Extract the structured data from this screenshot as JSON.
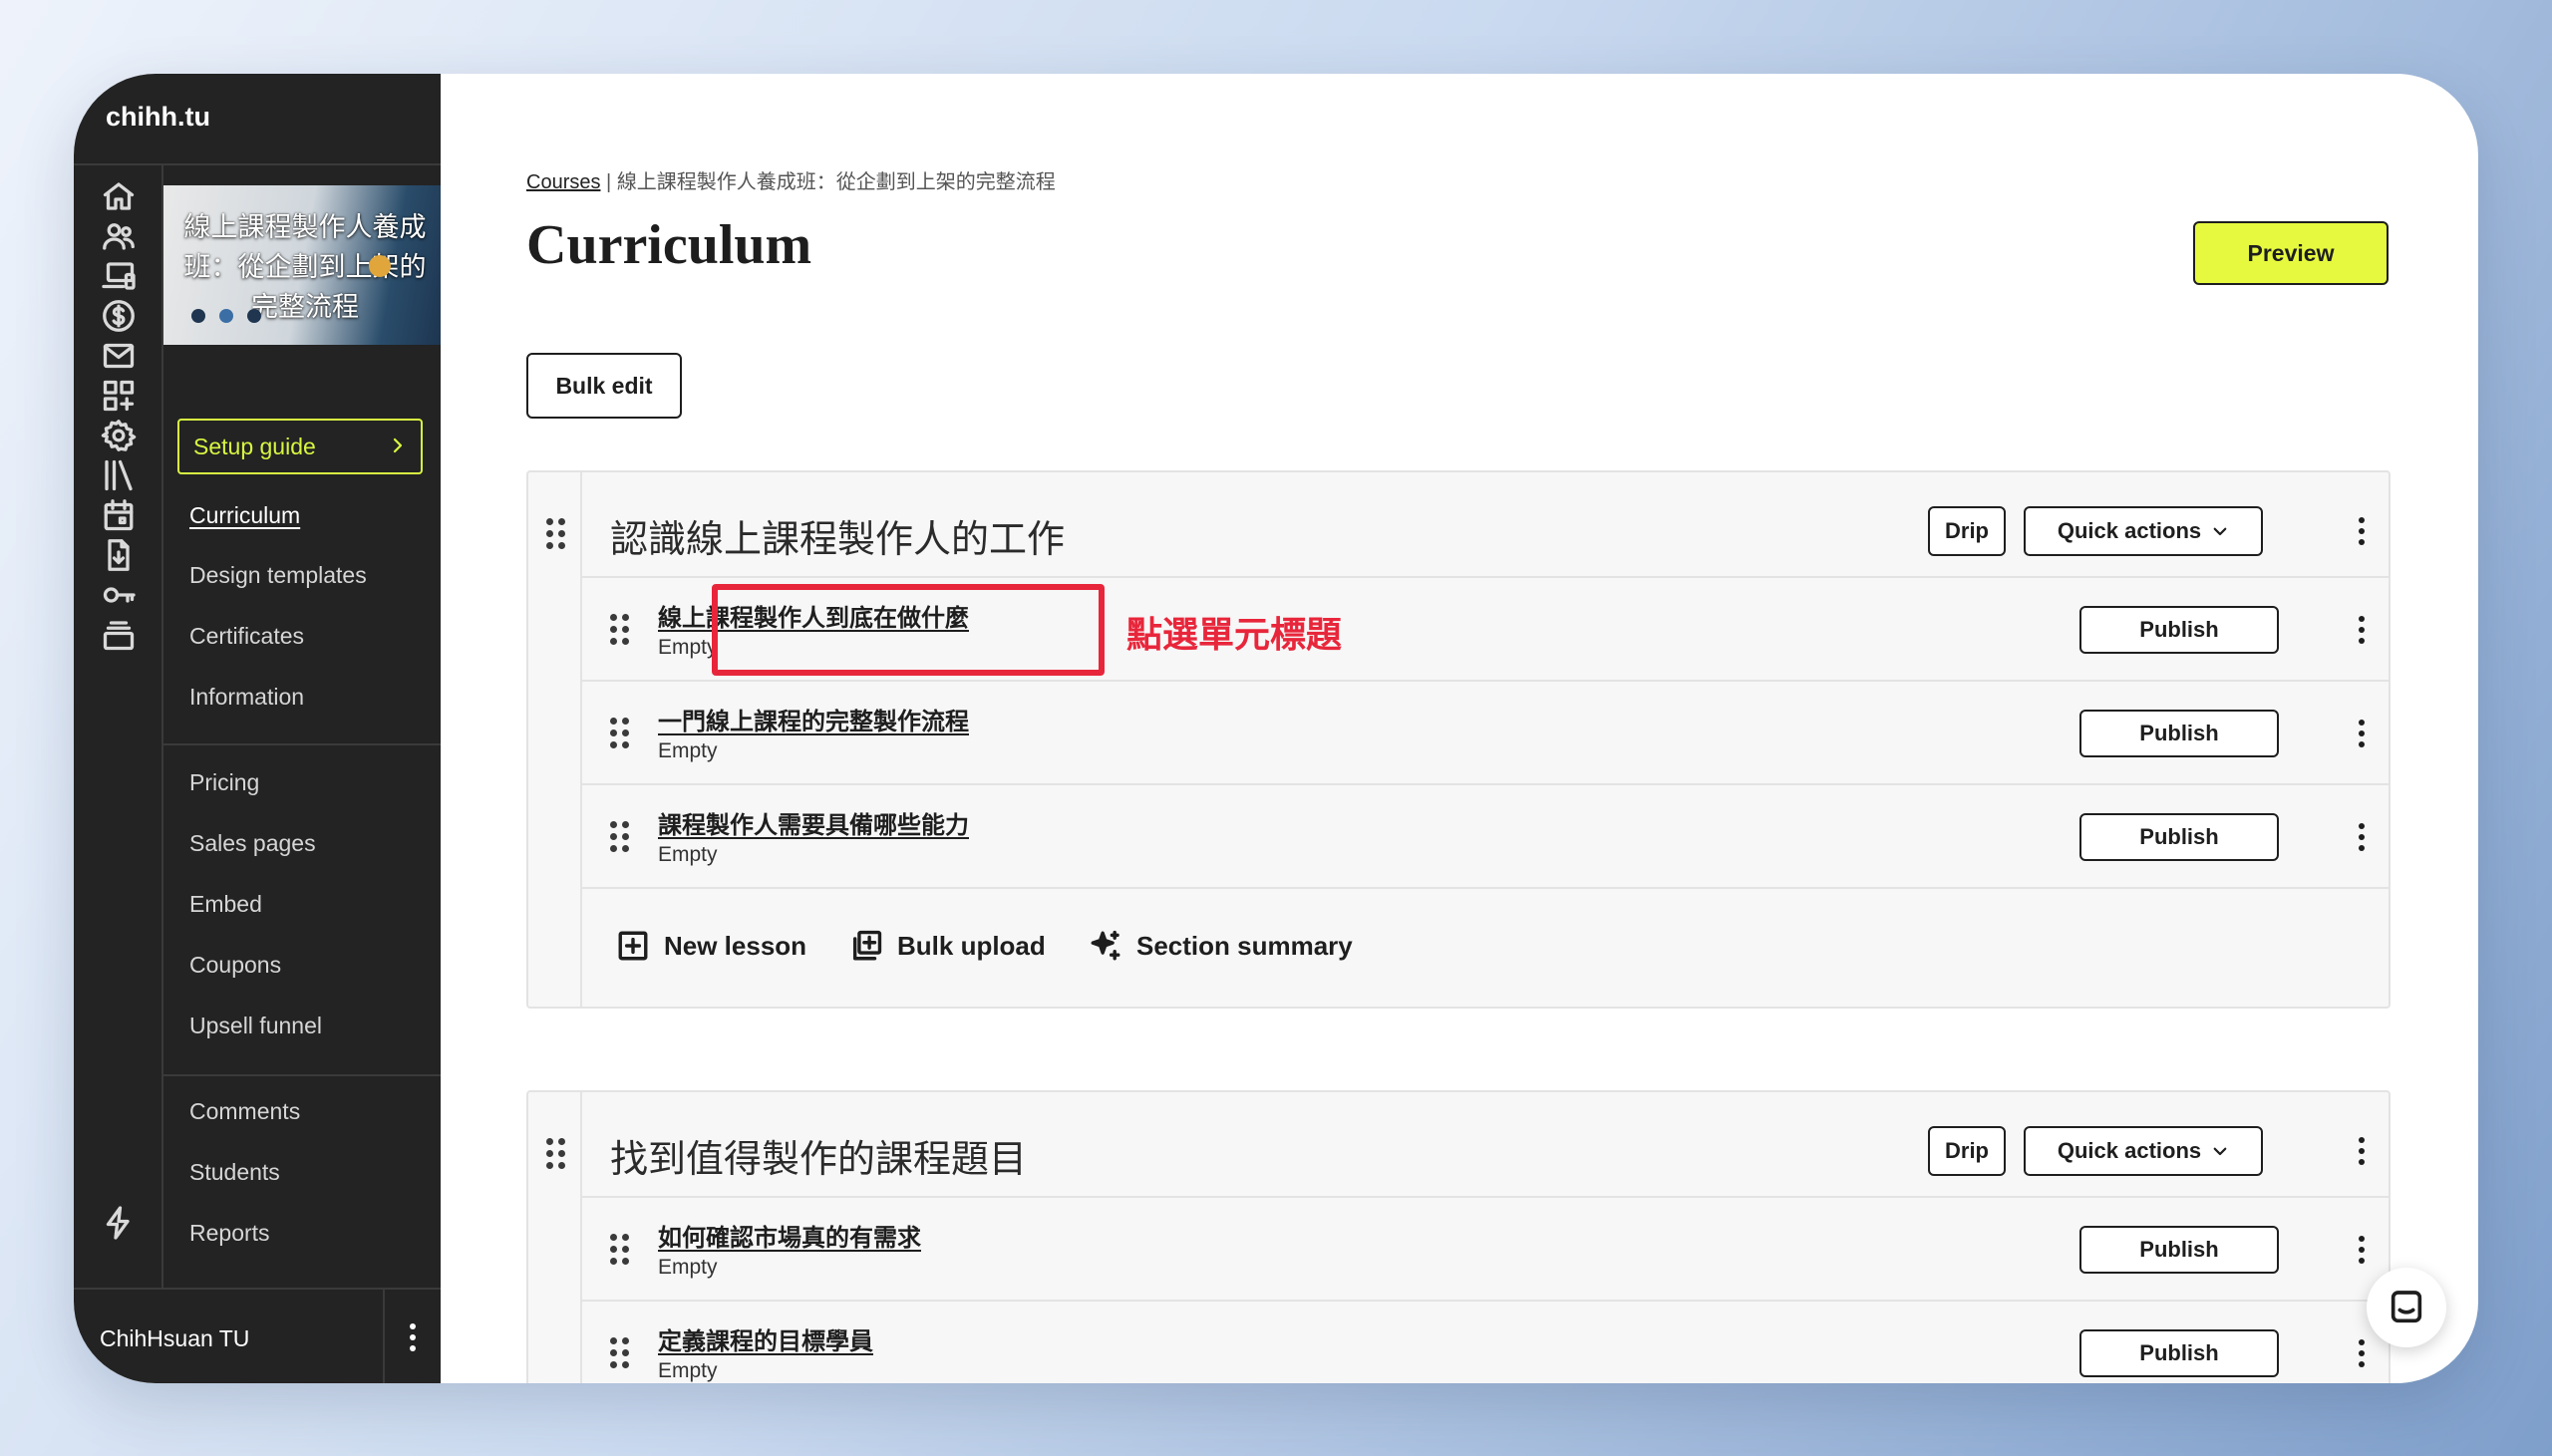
{
  "brand": "chihh.tu",
  "course_thumb": {
    "text": "線上課程製作人養成班：從企劃到上架的完整流程"
  },
  "setup_guide": "Setup guide",
  "nav": {
    "group1": [
      "Curriculum",
      "Design templates",
      "Certificates",
      "Information"
    ],
    "group2": [
      "Pricing",
      "Sales pages",
      "Embed",
      "Coupons",
      "Upsell funnel"
    ],
    "group3": [
      "Comments",
      "Students",
      "Reports"
    ],
    "active": "Curriculum"
  },
  "rail_icons": [
    "home-icon",
    "users-icon",
    "devices-icon",
    "dollar-icon",
    "mail-icon",
    "apps-icon",
    "gear-icon",
    "library-icon",
    "calendar-icon",
    "download-doc-icon",
    "key-icon",
    "stack-icon",
    "lightning-icon"
  ],
  "user": {
    "name": "ChihHsuan TU"
  },
  "breadcrumb": {
    "root": "Courses",
    "separator": "|",
    "current": "線上課程製作人養成班：從企劃到上架的完整流程"
  },
  "page_title": "Curriculum",
  "buttons": {
    "preview": "Preview",
    "bulk_edit": "Bulk edit",
    "drip": "Drip",
    "quick_actions": "Quick actions",
    "publish": "Publish"
  },
  "sections": [
    {
      "title": "認識線上課程製作人的工作",
      "lessons": [
        {
          "title": "線上課程製作人到底在做什麼",
          "status": "Empty"
        },
        {
          "title": "一門線上課程的完整製作流程",
          "status": "Empty"
        },
        {
          "title": "課程製作人需要具備哪些能力",
          "status": "Empty"
        }
      ],
      "actions": {
        "new_lesson": "New lesson",
        "bulk_upload": "Bulk upload",
        "section_summary": "Section summary"
      }
    },
    {
      "title": "找到值得製作的課程題目",
      "lessons": [
        {
          "title": "如何確認市場真的有需求",
          "status": "Empty"
        },
        {
          "title": "定義課程的目標學員",
          "status": "Empty"
        }
      ]
    }
  ],
  "annotation": "點選單元標題",
  "colors": {
    "accent": "#e6f93f",
    "rail_bg": "#232323",
    "highlight": "#e8263b"
  }
}
